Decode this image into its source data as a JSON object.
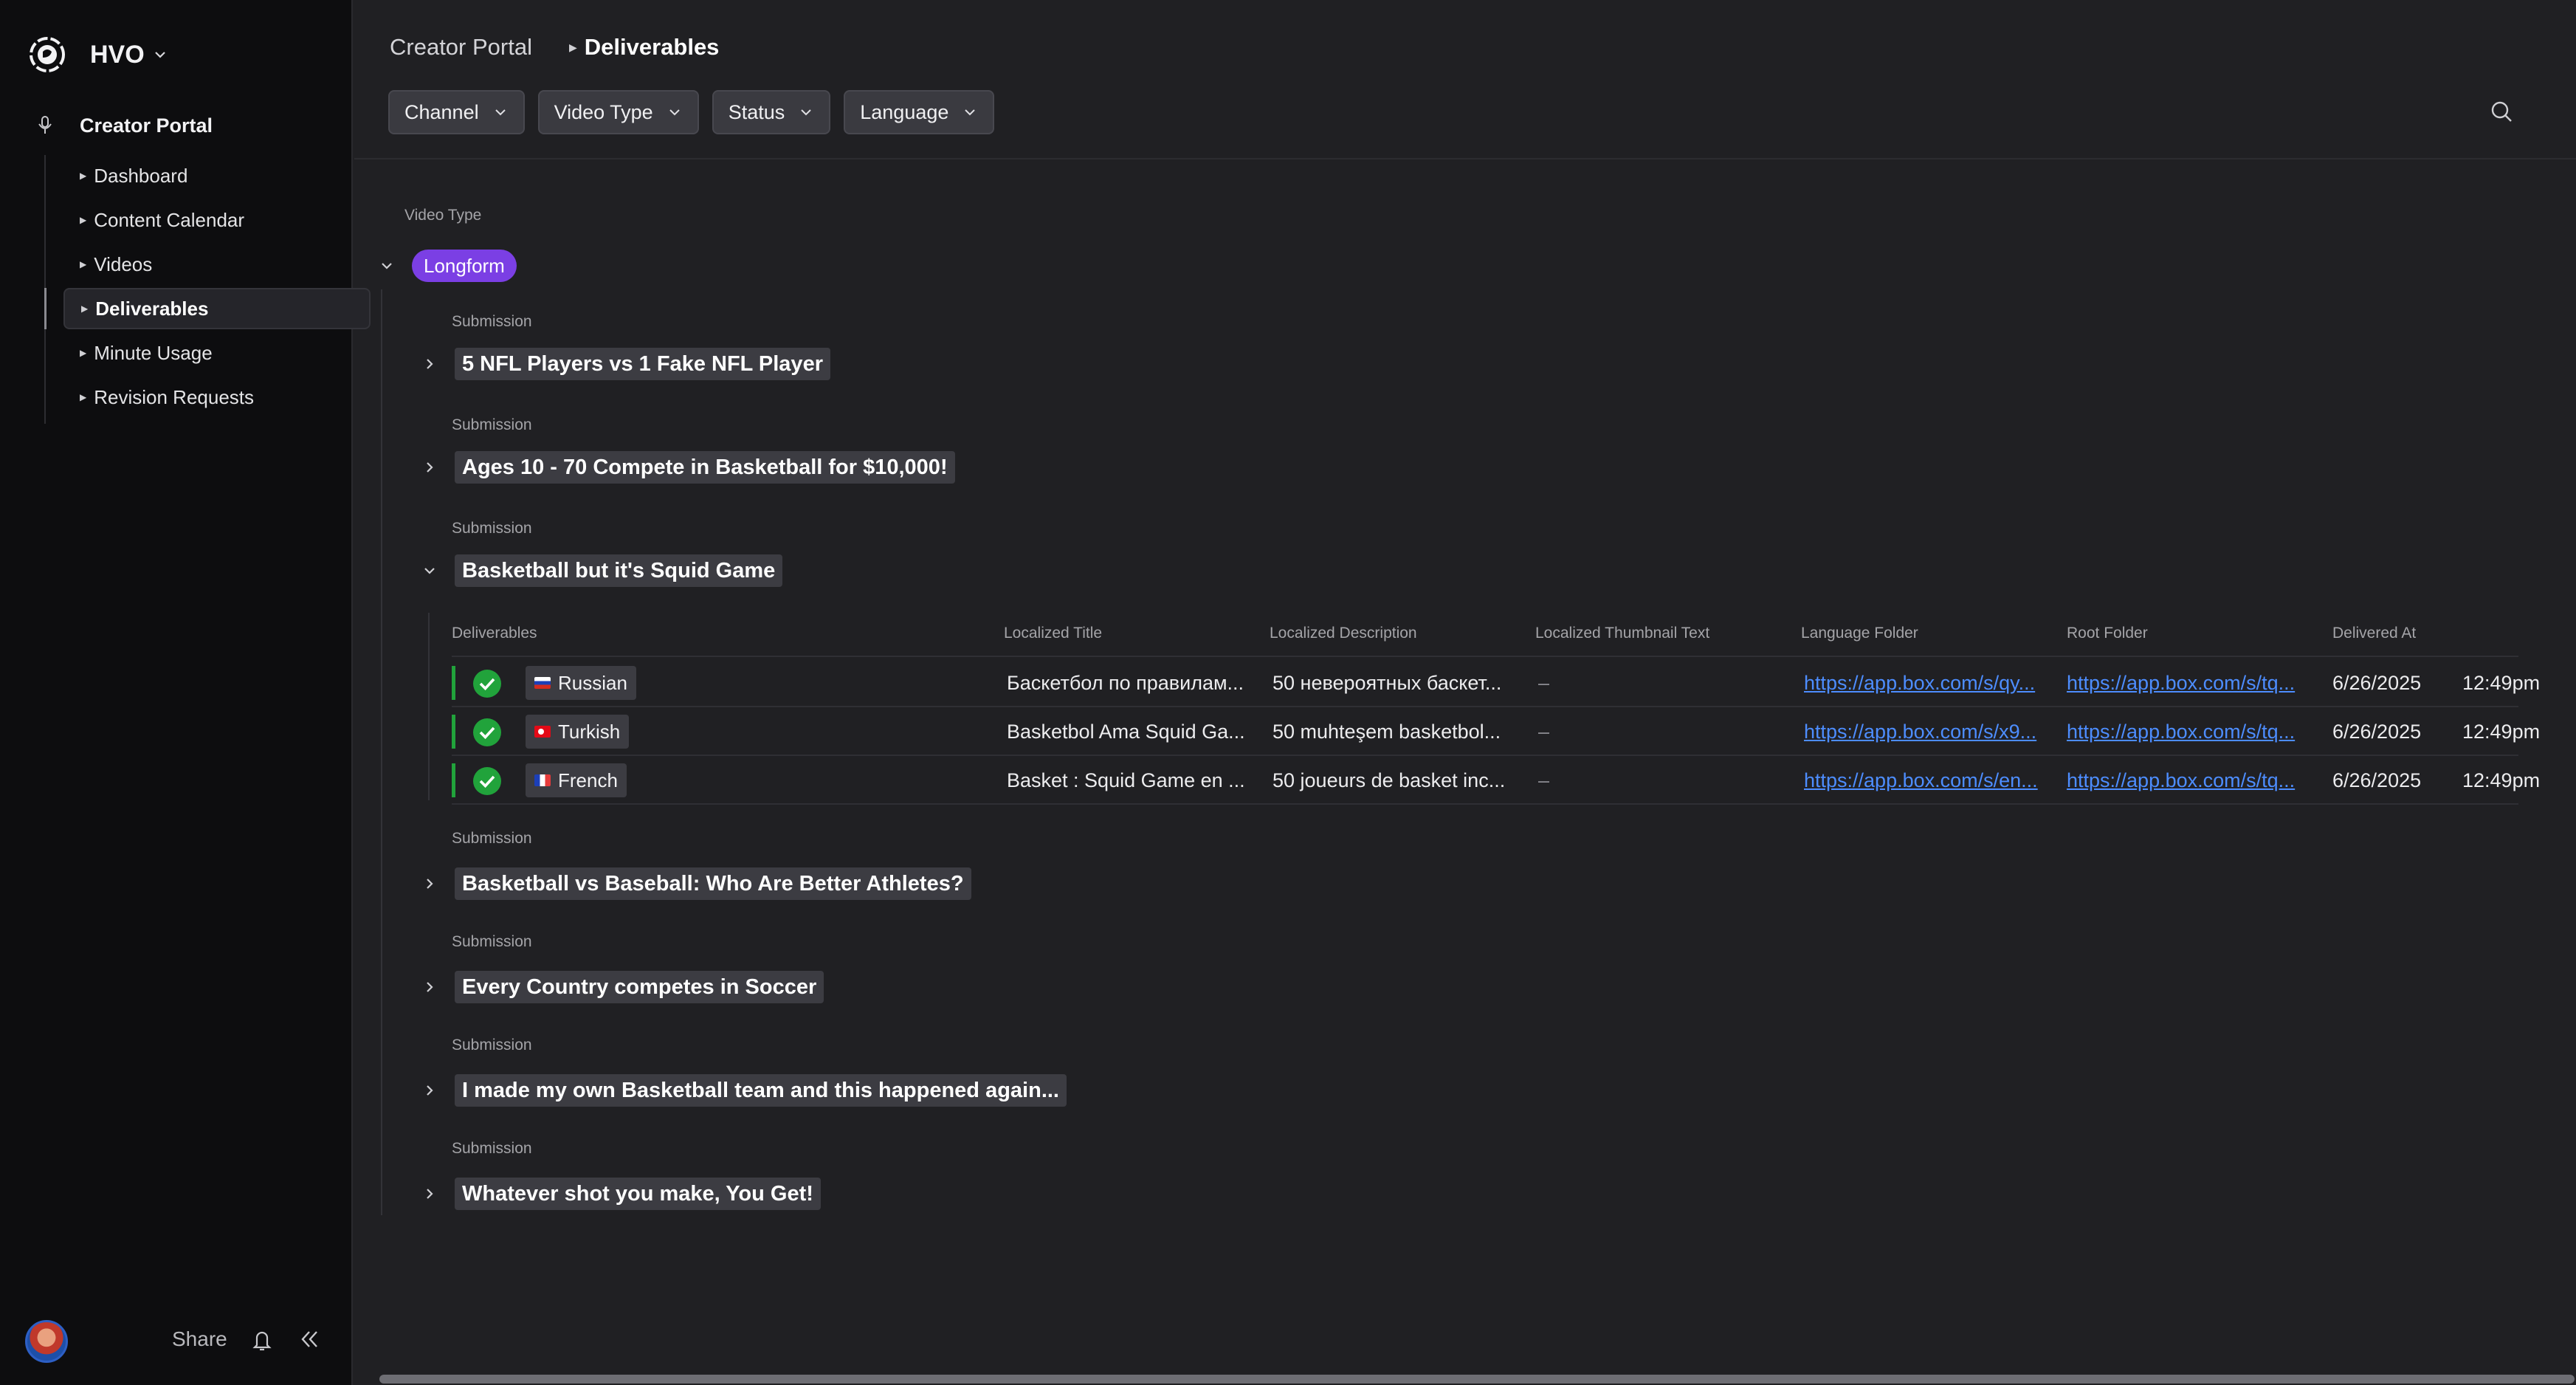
{
  "workspace": {
    "name": "HVO"
  },
  "sidebar": {
    "section": "Creator Portal",
    "items": [
      {
        "label": "Dashboard"
      },
      {
        "label": "Content Calendar"
      },
      {
        "label": "Videos"
      },
      {
        "label": "Deliverables",
        "active": true
      },
      {
        "label": "Minute Usage"
      },
      {
        "label": "Revision Requests"
      }
    ],
    "footer": {
      "share_label": "Share"
    }
  },
  "breadcrumb": {
    "root": "Creator Portal",
    "current": "Deliverables"
  },
  "filters": [
    "Channel",
    "Video Type",
    "Status",
    "Language"
  ],
  "group": {
    "header": "Video Type",
    "value": "Longform",
    "pill_color": "#7b3fe4"
  },
  "submission_label": "Submission",
  "submissions": [
    {
      "title": "5 NFL Players vs 1 Fake NFL Player",
      "expanded": false
    },
    {
      "title": "Ages 10 - 70 Compete in Basketball for $10,000!",
      "expanded": false
    },
    {
      "title": "Basketball but it's Squid Game",
      "expanded": true
    },
    {
      "title": "Basketball vs Baseball: Who Are Better Athletes?",
      "expanded": false
    },
    {
      "title": "Every Country competes in Soccer",
      "expanded": false
    },
    {
      "title": "I made my own Basketball team and this happened again...",
      "expanded": false
    },
    {
      "title": "Whatever shot you make, You Get!",
      "expanded": false
    }
  ],
  "deliverables": {
    "columns": [
      "Deliverables",
      "Localized Title",
      "Localized Description",
      "Localized Thumbnail Text",
      "Language Folder",
      "Root Folder",
      "Delivered At"
    ],
    "rows": [
      {
        "language": "Russian",
        "flag": "ru",
        "status": "complete",
        "title": "Баскетбол по правилам...",
        "description": "50 невероятных баскет...",
        "thumbnail_text": "–",
        "language_folder": "https://app.box.com/s/qy...",
        "root_folder": "https://app.box.com/s/tq...",
        "date": "6/26/2025",
        "time": "12:49pm"
      },
      {
        "language": "Turkish",
        "flag": "tr",
        "status": "complete",
        "title": "Basketbol Ama Squid Ga...",
        "description": "50 muhteşem basketbol...",
        "thumbnail_text": "–",
        "language_folder": "https://app.box.com/s/x9...",
        "root_folder": "https://app.box.com/s/tq...",
        "date": "6/26/2025",
        "time": "12:49pm"
      },
      {
        "language": "French",
        "flag": "fr",
        "status": "complete",
        "title": "Basket : Squid Game en ...",
        "description": "50 joueurs de basket inc...",
        "thumbnail_text": "–",
        "language_folder": "https://app.box.com/s/en...",
        "root_folder": "https://app.box.com/s/tq...",
        "date": "6/26/2025",
        "time": "12:49pm"
      }
    ]
  },
  "colors": {
    "accent_purple": "#7b3fe4",
    "success_green": "#21a33b",
    "link_blue": "#4d8dff"
  }
}
